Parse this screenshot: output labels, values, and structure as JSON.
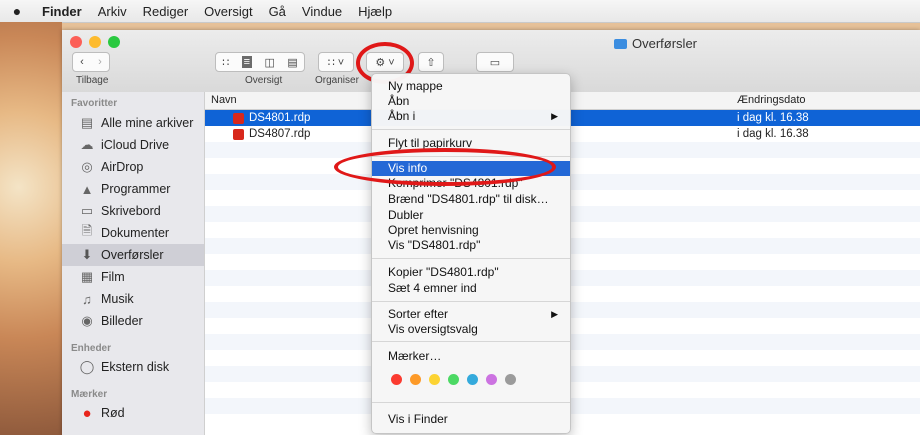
{
  "menubar": {
    "apple": "",
    "items": [
      "Finder",
      "Arkiv",
      "Rediger",
      "Oversigt",
      "Gå",
      "Vindue",
      "Hjælp"
    ]
  },
  "window": {
    "title": "Overførsler"
  },
  "toolbar": {
    "back_label": "Tilbage",
    "view_label": "Oversigt",
    "arrange_label": "Organiser"
  },
  "sidebar": {
    "favorites_header": "Favoritter",
    "favorites": [
      "Alle mine arkiver",
      "iCloud Drive",
      "AirDrop",
      "Programmer",
      "Skrivebord",
      "Dokumenter",
      "Overførsler",
      "Film",
      "Musik",
      "Billeder"
    ],
    "devices_header": "Enheder",
    "devices": [
      "Ekstern disk"
    ],
    "tags_header": "Mærker",
    "tags": [
      "Rød"
    ]
  },
  "list": {
    "col_name": "Navn",
    "col_date": "Ændringsdato",
    "rows": [
      {
        "name": "DS4801.rdp",
        "date": "i dag kl. 16.38"
      },
      {
        "name": "DS4807.rdp",
        "date": "i dag kl. 16.38"
      }
    ]
  },
  "menu": {
    "items": [
      "Ny mappe",
      "Åbn",
      "Åbn i",
      "Flyt til papirkurv",
      "Vis info",
      "Komprimer \"DS4801.rdp\"",
      "Brænd \"DS4801.rdp\" til disk…",
      "Dubler",
      "Opret henvisning",
      "Vis \"DS4801.rdp\"",
      "Kopier \"DS4801.rdp\"",
      "Sæt 4 emner ind",
      "Sorter efter",
      "Vis oversigtsvalg",
      "Mærker…",
      "Vis i Finder"
    ],
    "tag_colors": [
      "#fb3b30",
      "#fd9a28",
      "#fcd332",
      "#4cd964",
      "#34aadc",
      "#cc73e1",
      "#9b9b9b"
    ]
  },
  "colors": {
    "selection": "#0f63d6",
    "menu_highlight": "#2368d6",
    "annotation": "#e01818"
  }
}
